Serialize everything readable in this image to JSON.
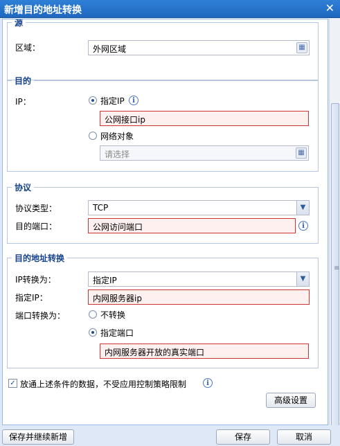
{
  "dialog": {
    "title": "新增目的地址转换"
  },
  "source": {
    "legend": "源",
    "zone_label": "区域：",
    "zone_value": "外网区域"
  },
  "destination": {
    "legend": "目的",
    "ip_label": "IP：",
    "opt_specify_ip": "指定IP",
    "ip_value": "公网接口ip",
    "opt_network_object": "网络对象",
    "network_object_placeholder": "请选择"
  },
  "protocol": {
    "legend": "协议",
    "type_label": "协议类型：",
    "type_value": "TCP",
    "port_label": "目的端口：",
    "port_value": "公网访问端口"
  },
  "dnat": {
    "legend": "目的地址转换",
    "ip_convert_label": "IP转换为：",
    "ip_convert_value": "指定IP",
    "specify_ip_label": "指定IP：",
    "specify_ip_value": "内网服务器ip",
    "port_convert_label": "端口转换为：",
    "opt_no_convert": "不转换",
    "opt_specify_port": "指定端口",
    "port_value": "内网服务器开放的真实端口"
  },
  "bypass_checkbox_label": "放通上述条件的数据，不受应用控制策略限制",
  "buttons": {
    "advanced": "高级设置",
    "save_continue": "保存并继续新增",
    "save": "保存",
    "cancel": "取消"
  },
  "icons": {
    "close": "close-icon",
    "picker": "picker-icon",
    "info": "info-icon",
    "dropdown": "chevron-down-icon"
  },
  "colors": {
    "title_bar": "#1f68c0",
    "legend_text": "#15428b",
    "error_border": "#cc3333"
  }
}
